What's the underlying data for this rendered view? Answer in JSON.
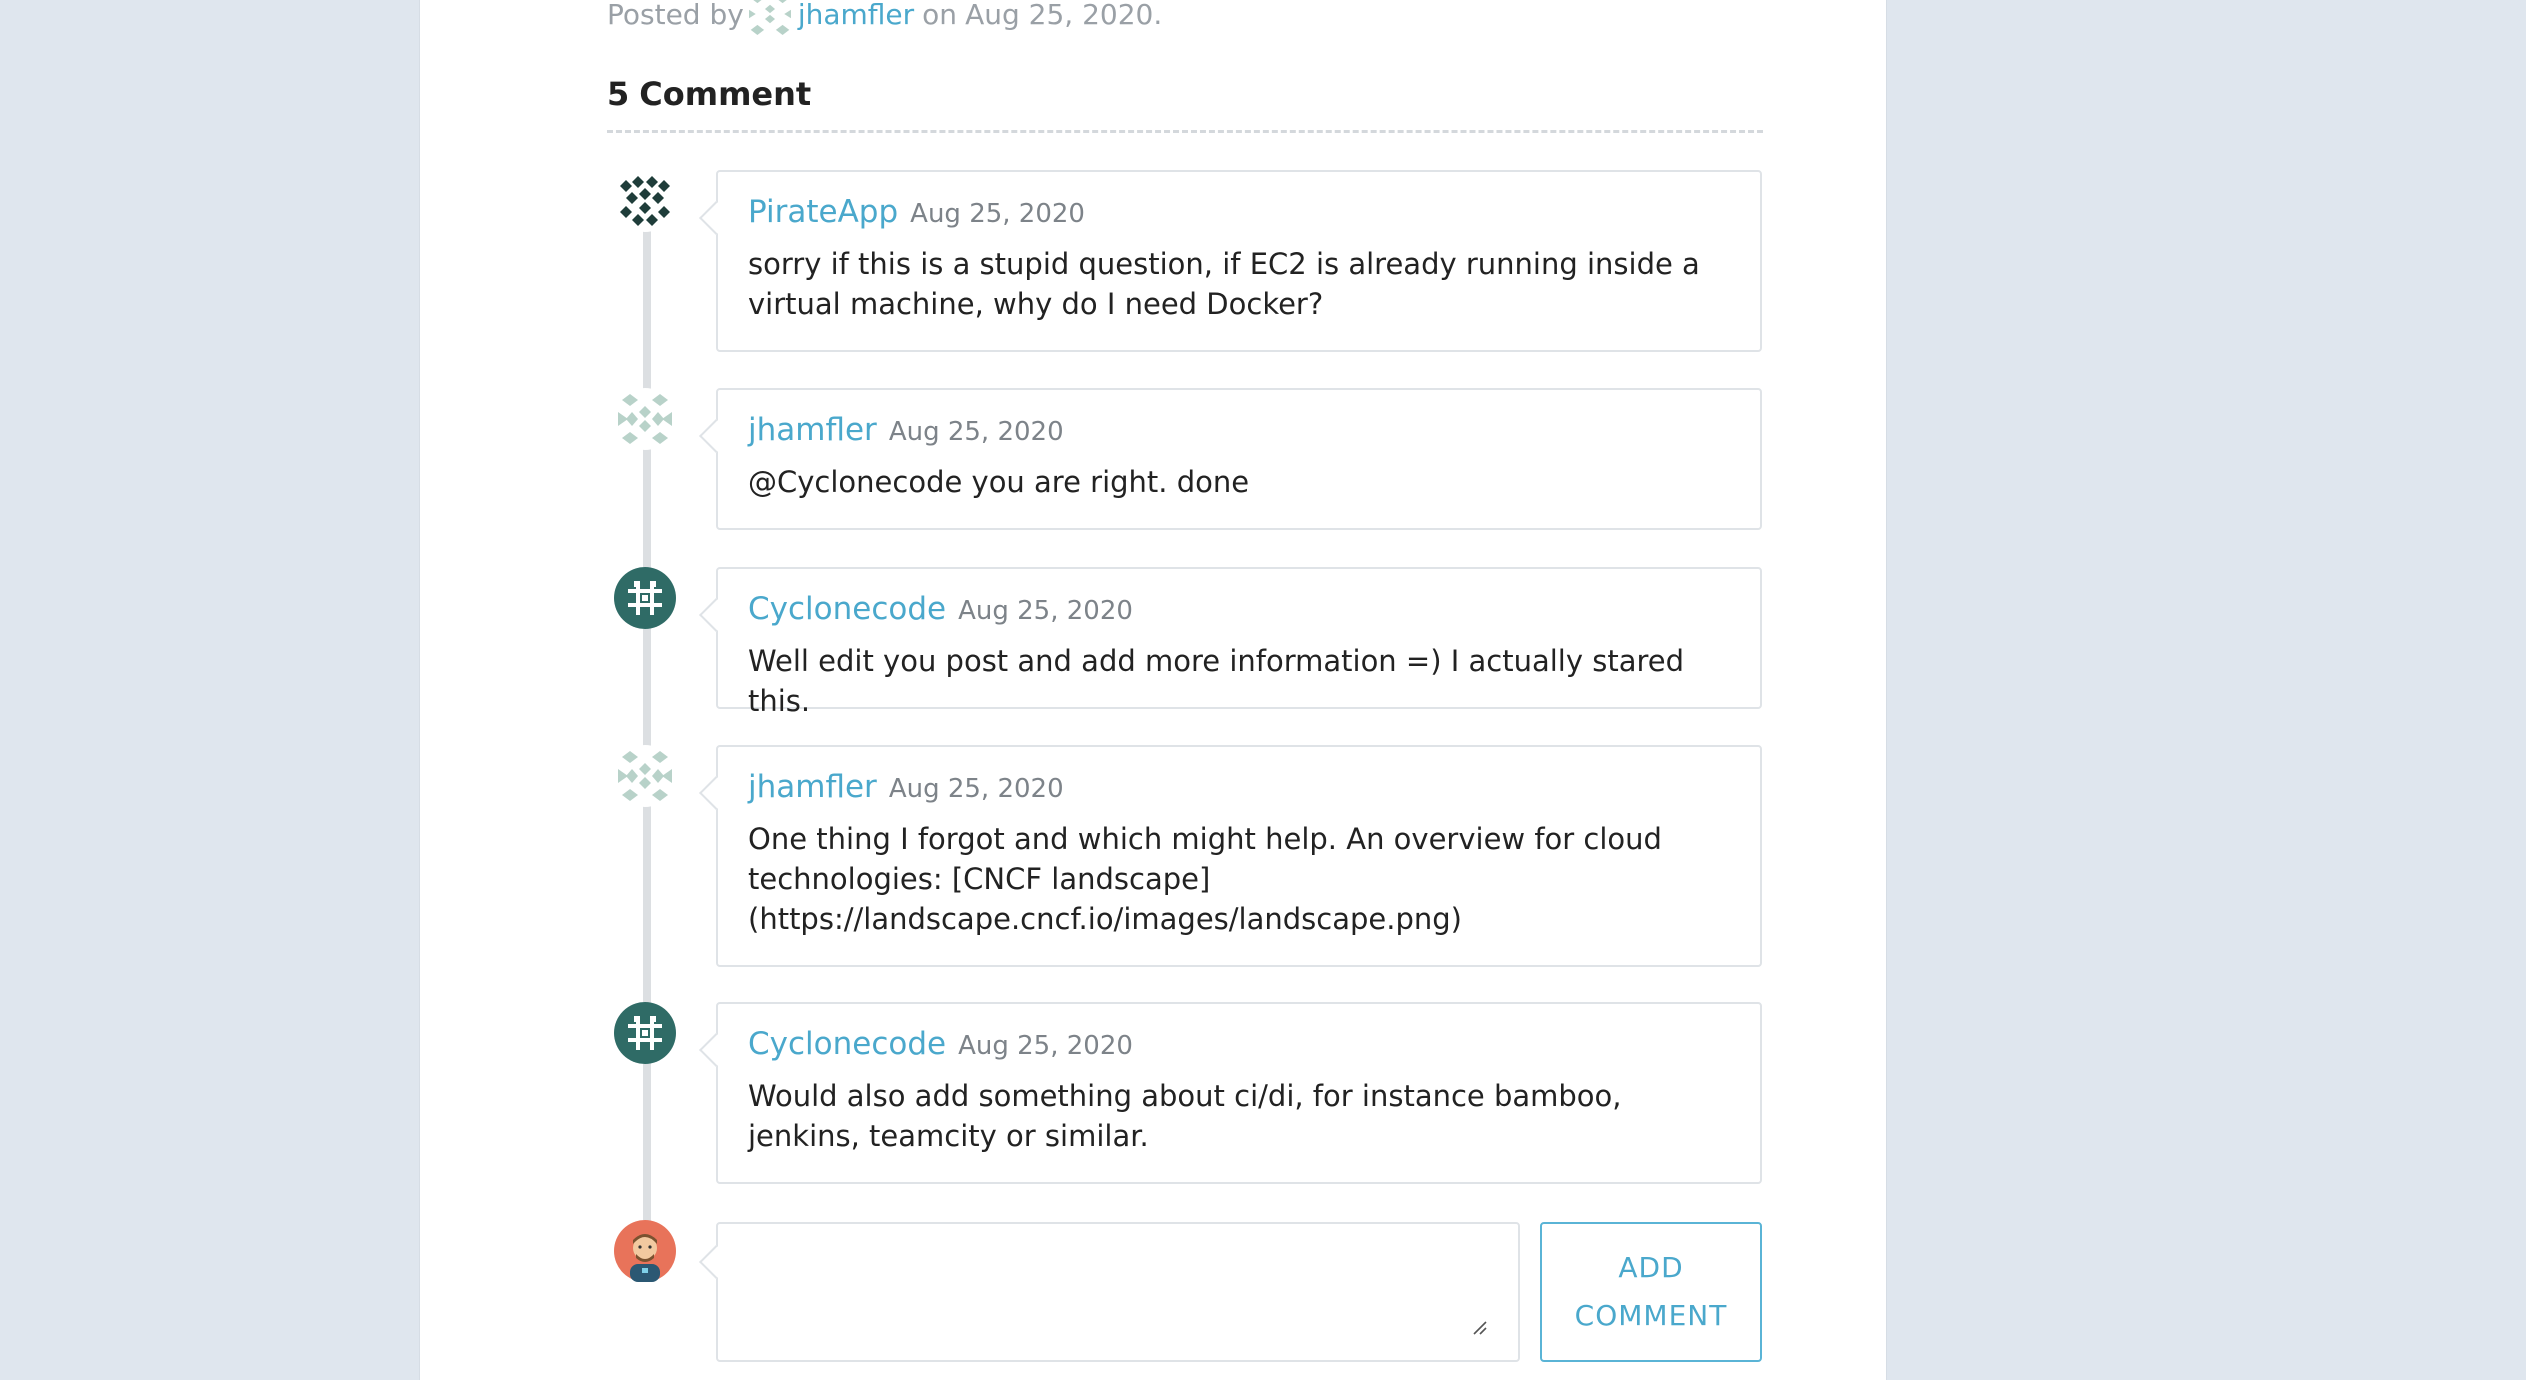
{
  "post": {
    "posted_by_prefix": "Posted by",
    "author": "jhamfler",
    "on_text": "on",
    "date": "Aug 25, 2020."
  },
  "comments_header": {
    "count": "5",
    "label": "Comment"
  },
  "comments": [
    {
      "user": "PirateApp",
      "date": "Aug 25, 2020",
      "text": "sorry if this is a stupid question, if EC2 is already running inside a virtual machine, why do I need Docker?"
    },
    {
      "user": "jhamfler",
      "date": "Aug 25, 2020",
      "text": "@Cyclonecode you are right. done"
    },
    {
      "user": "Cyclonecode",
      "date": "Aug 25, 2020",
      "text": "Well edit you post and add more information =) I actually stared this."
    },
    {
      "user": "jhamfler",
      "date": "Aug 25, 2020",
      "text": "One thing I forgot and which might help. An overview for cloud technologies: [CNCF landscape](https://landscape.cncf.io/images/landscape.png)"
    },
    {
      "user": "Cyclonecode",
      "date": "Aug 25, 2020",
      "text": "Would also add something about ci/di, for instance bamboo, jenkins, teamcity or similar."
    }
  ],
  "composer": {
    "value": "",
    "button_label": "ADD COMMENT"
  },
  "colors": {
    "accent": "#4aa8cc",
    "background": "#dfe6ee",
    "timeline": "#dcdfe2",
    "border": "#dfe3e7"
  }
}
